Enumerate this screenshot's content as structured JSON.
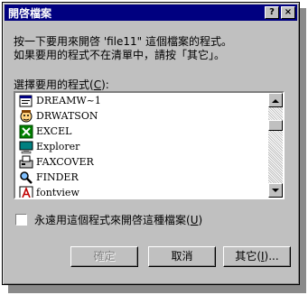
{
  "window": {
    "title": "開啓檔案",
    "help_btn": "?",
    "close_btn": "×"
  },
  "instructions": {
    "line1": "按一下要用來開啓 'file11\" 這個檔案的程式。",
    "line2": "如果要用的程式不在清單中，請按「其它」。"
  },
  "program_list": {
    "label": "選擇要用的程式",
    "label_accel": "C",
    "items": [
      {
        "label": "DREAMW~1",
        "icon": "dreamweaver-icon"
      },
      {
        "label": "DRWATSON",
        "icon": "drwatson-icon"
      },
      {
        "label": "EXCEL",
        "icon": "excel-icon"
      },
      {
        "label": "Explorer",
        "icon": "explorer-icon"
      },
      {
        "label": "FAXCOVER",
        "icon": "faxcover-icon"
      },
      {
        "label": "FINDER",
        "icon": "finder-icon"
      },
      {
        "label": "fontview",
        "icon": "fontview-icon"
      }
    ]
  },
  "always_use": {
    "label": "永遠用這個程式來開啓這種檔案",
    "accel": "U",
    "checked": false
  },
  "buttons": {
    "ok": "確定",
    "cancel": "取消",
    "other": "其它",
    "other_accel": "I",
    "other_suffix": "..."
  },
  "colors": {
    "titlebar": "#000080",
    "face": "#c0c0c0"
  }
}
